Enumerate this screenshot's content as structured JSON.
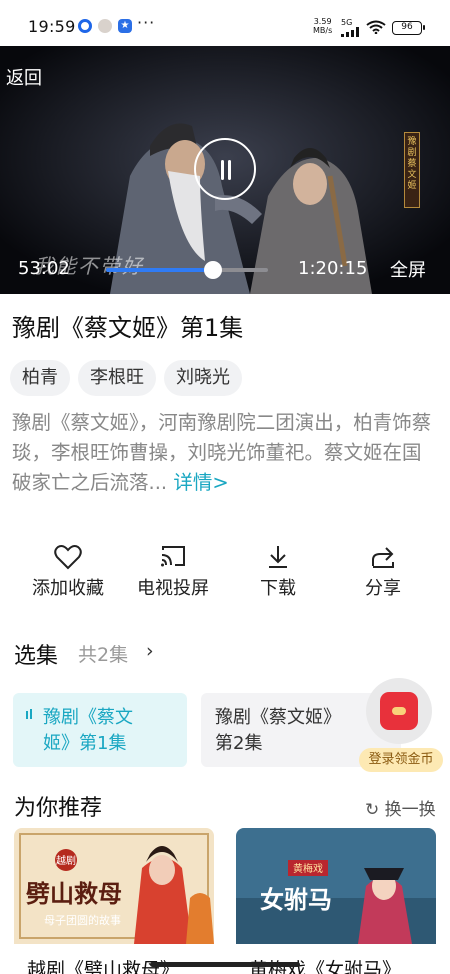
{
  "status_bar": {
    "time": "19:59",
    "network_speed_value": "3.59",
    "network_speed_unit": "MB/s",
    "signal": "5G",
    "battery": "96",
    "more": "···"
  },
  "player": {
    "back_label": "返回",
    "current_time": "53:02",
    "total_time": "1:20:15",
    "progress_fraction": 0.66,
    "fullscreen_label": "全屏",
    "caption": "我能不带好",
    "banner_text": "豫剧 蔡文姬"
  },
  "video": {
    "title": "豫剧《蔡文姬》第1集",
    "cast_tags": [
      "柏青",
      "李根旺",
      "刘晓光"
    ],
    "description": "豫剧《蔡文姬》，河南豫剧院二团演出，柏青饰蔡琰，李根旺饰曹操，刘晓光饰董祀。蔡文姬在国破家亡之后流落...",
    "more_label": "详情>"
  },
  "actions": [
    {
      "label": "添加收藏",
      "icon": "heart-icon"
    },
    {
      "label": "电视投屏",
      "icon": "cast-icon"
    },
    {
      "label": "下载",
      "icon": "download-icon"
    },
    {
      "label": "分享",
      "icon": "share-icon"
    }
  ],
  "episodes": {
    "section_title": "选集",
    "count_label": "共2集",
    "chevron": "›",
    "items": [
      {
        "label": "豫剧《蔡文姬》第1集",
        "line1": "豫剧《蔡文",
        "line2": "姬》第1集",
        "active": true
      },
      {
        "label": "豫剧《蔡文姬》第2集",
        "line1": "豫剧《蔡文姬》",
        "line2": "第2集",
        "active": false
      }
    ]
  },
  "coin_widget": {
    "label": "登录领金币"
  },
  "recommend": {
    "section_title": "为你推荐",
    "refresh_label": "换一换",
    "items": [
      {
        "title": "越剧《劈山救母》",
        "poster_tag": "越剧",
        "poster_title": "劈山救母",
        "poster_subtitle": "母子团圆的故事"
      },
      {
        "title": "黄梅戏《女驸马》",
        "poster_tag": "黄梅戏",
        "poster_title": "女驸马"
      }
    ]
  },
  "colors": {
    "accent": "#1aa7c2",
    "progress": "#2f7bf5",
    "active_episode_bg": "#e3f6f8",
    "coin_red": "#e8313b"
  }
}
